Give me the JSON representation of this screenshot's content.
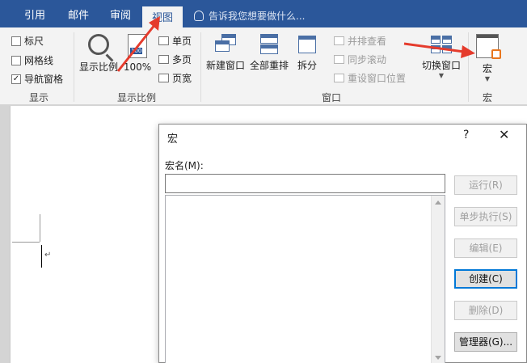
{
  "tabs": {
    "references": "引用",
    "mailings": "邮件",
    "review": "审阅",
    "view": "视图",
    "tell_me": "告诉我您想要做什么..."
  },
  "ribbon": {
    "show": {
      "ruler": "标尺",
      "gridlines": "网格线",
      "nav_pane": "导航窗格",
      "ruler_checked": false,
      "gridlines_checked": false,
      "nav_pane_checked": true,
      "label": "显示"
    },
    "zoom": {
      "zoom": "显示比例",
      "percent": "100%",
      "one_page": "单页",
      "multi_page": "多页",
      "page_width": "页宽",
      "label": "显示比例",
      "badge": "100"
    },
    "window": {
      "new_window": "新建窗口",
      "arrange_all": "全部重排",
      "split": "拆分",
      "side_by_side": "并排查看",
      "sync_scroll": "同步滚动",
      "reset_position": "重设窗口位置",
      "switch_windows": "切换窗口",
      "label": "窗口"
    },
    "macros": {
      "macros": "宏",
      "label": "宏"
    }
  },
  "dialog": {
    "title": "宏",
    "help": "?",
    "close": "✕",
    "name_label": "宏名(M):",
    "name_value": "",
    "buttons": {
      "run": "运行(R)",
      "step_into": "单步执行(S)",
      "edit": "编辑(E)",
      "create": "创建(C)",
      "delete": "删除(D)",
      "organizer": "管理器(G)..."
    }
  },
  "document": {
    "paragraph_mark": "↵"
  },
  "colors": {
    "title_bar": "#2b579a",
    "ribbon_bg": "#f3f3f3",
    "annotation_arrow": "#e53b2c",
    "focus_border": "#0078d7",
    "macro_icon_accent": "#e8761e"
  }
}
